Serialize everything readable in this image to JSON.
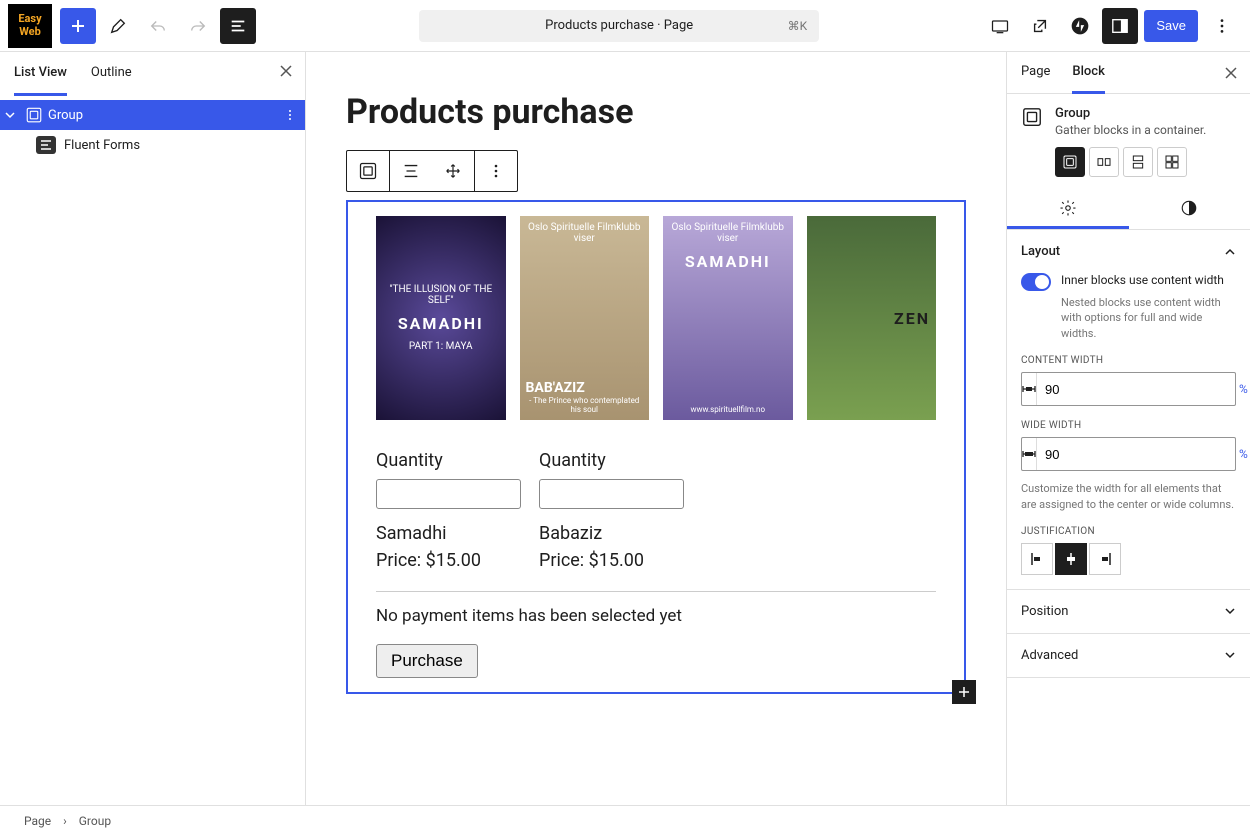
{
  "logo": {
    "line1": "Easy",
    "line2": "Web"
  },
  "topbar": {
    "title": "Products purchase · Page",
    "shortcut": "⌘K",
    "save": "Save"
  },
  "left": {
    "tabs": {
      "list": "List View",
      "outline": "Outline"
    },
    "tree": {
      "group": "Group",
      "fluent": "Fluent Forms"
    }
  },
  "canvas": {
    "page_title": "Products purchase",
    "posters": [
      {
        "tag": "\"THE ILLUSION OF THE SELF\"",
        "title": "SAMADHI",
        "sub": "PART 1: MAYA"
      },
      {
        "tag": "Oslo Spirituelle Filmklubb viser",
        "title": "BAB'AZIZ",
        "sub": "- The Prince who contemplated his soul"
      },
      {
        "tag": "Oslo Spirituelle Filmklubb viser",
        "title": "SAMADHI",
        "sub": "www.spirituellfilm.no"
      },
      {
        "tag": "",
        "title": "ZEN",
        "sub": ""
      }
    ],
    "form": {
      "qty_label": "Quantity",
      "items": [
        {
          "name": "Samadhi",
          "price": "Price: $15.00"
        },
        {
          "name": "Babaziz",
          "price": "Price: $15.00"
        }
      ],
      "empty": "No payment items has been selected yet",
      "button": "Purchase"
    }
  },
  "right": {
    "tabs": {
      "page": "Page",
      "block": "Block"
    },
    "block": {
      "title": "Group",
      "desc": "Gather blocks in a container."
    },
    "layout": {
      "heading": "Layout",
      "toggle_label": "Inner blocks use content width",
      "help": "Nested blocks use content width with options for full and wide widths.",
      "content_width_label": "CONTENT WIDTH",
      "content_width_value": "90",
      "wide_width_label": "WIDE WIDTH",
      "wide_width_value": "90",
      "unit": "%",
      "customize_help": "Customize the width for all elements that are assigned to the center or wide columns.",
      "justification_label": "JUSTIFICATION"
    },
    "position": "Position",
    "advanced": "Advanced"
  },
  "breadcrumb": {
    "page": "Page",
    "group": "Group"
  }
}
